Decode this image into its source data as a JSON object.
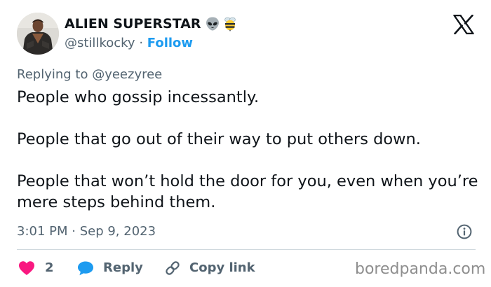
{
  "header": {
    "display_name": "ALIEN SUPERSTAR",
    "badges": [
      "alien-emoji",
      "bee-emoji"
    ],
    "handle": "@stillkocky",
    "separator": "·",
    "follow_label": "Follow"
  },
  "tweet": {
    "replying_to": "Replying to @yeezyree",
    "paragraphs": [
      "People who gossip incessantly.",
      "People that go out of their way to put others down.",
      "People that won’t hold the door for you, even when you’re mere steps behind them."
    ],
    "timestamp": "3:01 PM · Sep 9, 2023"
  },
  "actions": {
    "like_count": "2",
    "reply_label": "Reply",
    "copy_link_label": "Copy link"
  },
  "watermark": "boredpanda.com",
  "colors": {
    "text": "#0f1419",
    "secondary": "#536471",
    "link": "#1d9bf0",
    "like": "#f91880",
    "divider": "#cfd9de",
    "watermark": "#8e8e8e"
  }
}
